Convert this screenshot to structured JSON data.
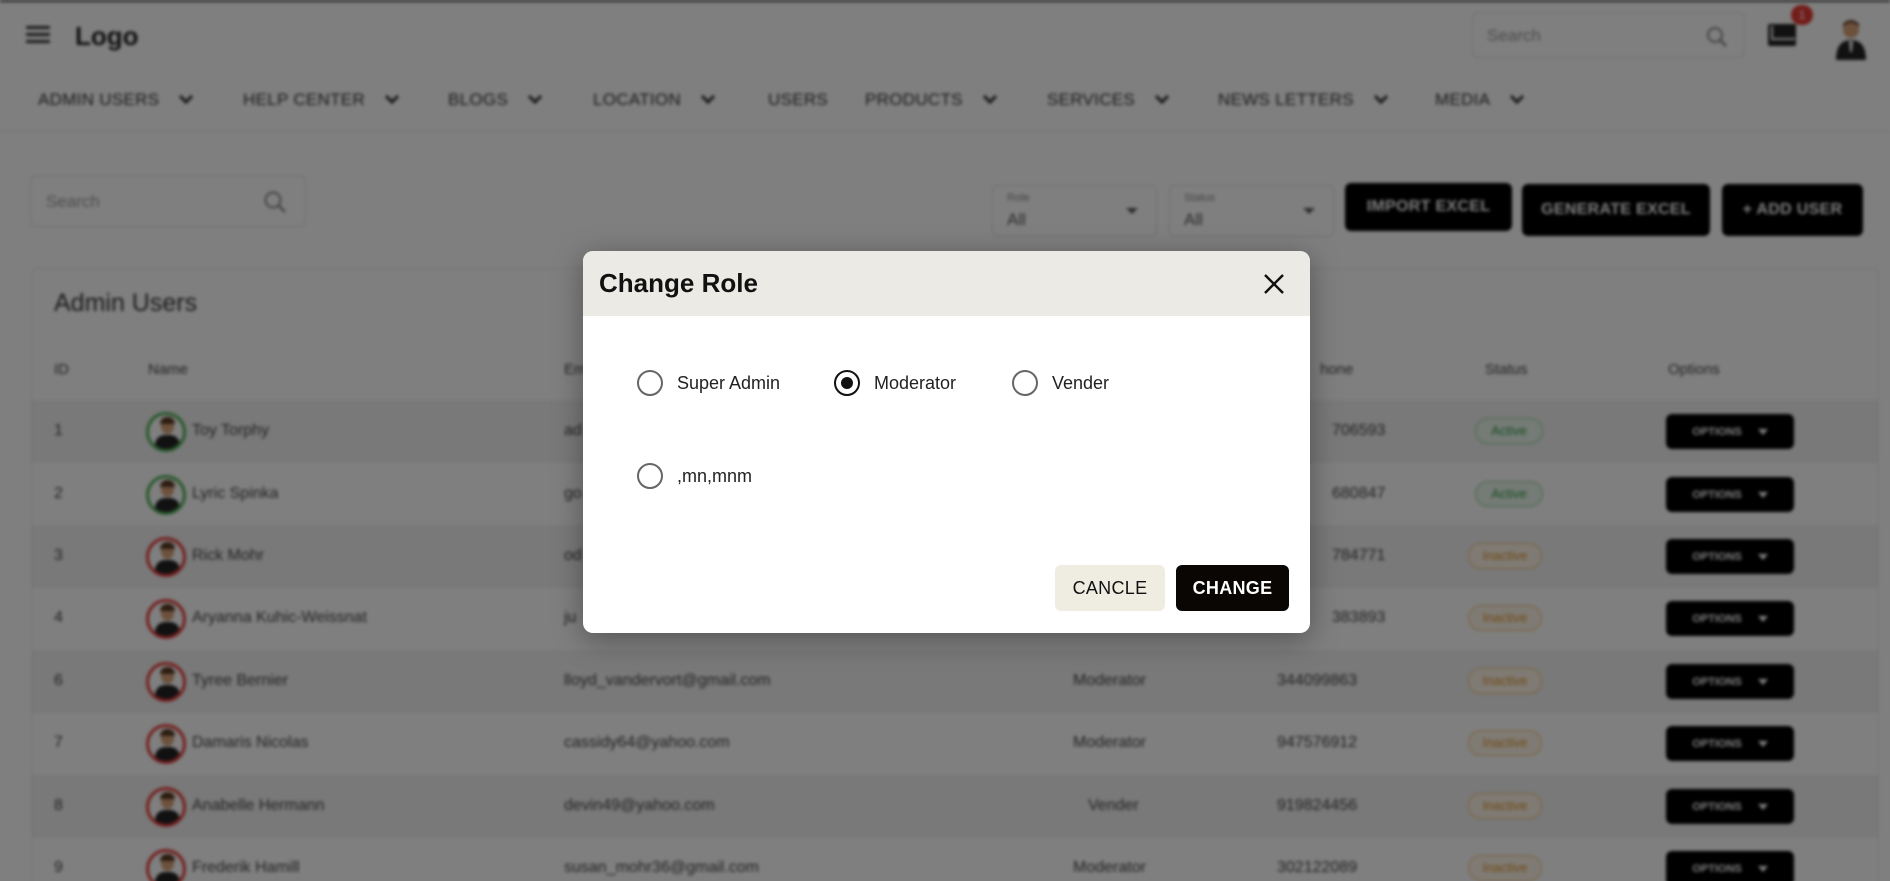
{
  "header": {
    "logo": "Logo",
    "search_placeholder": "Search",
    "notification_count": "1",
    "icons": [
      "menu-icon",
      "search-icon",
      "mail-icon",
      "profile-avatar"
    ]
  },
  "nav": {
    "items": [
      {
        "label": "ADMIN USERS",
        "has_dropdown": true
      },
      {
        "label": "HELP CENTER",
        "has_dropdown": true
      },
      {
        "label": "BLOGS",
        "has_dropdown": true
      },
      {
        "label": "LOCATION",
        "has_dropdown": true
      },
      {
        "label": "USERS",
        "has_dropdown": false
      },
      {
        "label": "PRODUCTS",
        "has_dropdown": true
      },
      {
        "label": "SERVICES",
        "has_dropdown": true
      },
      {
        "label": "NEWS LETTERS",
        "has_dropdown": true
      },
      {
        "label": "MEDIA",
        "has_dropdown": true
      }
    ]
  },
  "filters": {
    "search_placeholder": "Search",
    "role": {
      "label": "Role",
      "value": "All"
    },
    "status": {
      "label": "Status",
      "value": "All"
    },
    "import_label": "IMPORT EXCEL",
    "generate_label": "GENERATE EXCEL",
    "add_label": "+ ADD USER"
  },
  "table": {
    "title": "Admin Users",
    "headers": {
      "id": "ID",
      "name": "Name",
      "email": "Em",
      "phone": "hone",
      "status": "Status",
      "options": "Options"
    },
    "option_label": "OPTIONS",
    "rows": [
      {
        "id": "1",
        "name": "Toy Torphy",
        "email": "ad",
        "role": "",
        "phone": "706593",
        "status": "Active"
      },
      {
        "id": "2",
        "name": "Lyric Spinka",
        "email": "go",
        "role": "",
        "phone": "680847",
        "status": "Active"
      },
      {
        "id": "3",
        "name": "Rick Mohr",
        "email": "od",
        "role": "",
        "phone": "784771",
        "status": "Inactive"
      },
      {
        "id": "4",
        "name": "Aryanna Kuhic-Weissnat",
        "email": "ju",
        "role": "",
        "phone": "383893",
        "status": "Inactive"
      },
      {
        "id": "6",
        "name": "Tyree Bernier",
        "email": "lloyd_vandervort@gmail.com",
        "role": "Moderator",
        "phone": "344099863",
        "status": "Inactive"
      },
      {
        "id": "7",
        "name": "Damaris Nicolas",
        "email": "cassidy64@yahoo.com",
        "role": "Moderator",
        "phone": "947576912",
        "status": "Inactive"
      },
      {
        "id": "8",
        "name": "Anabelle Hermann",
        "email": "devin49@yahoo.com",
        "role": "Vender",
        "phone": "919824456",
        "status": "Inactive"
      },
      {
        "id": "9",
        "name": "Frederik Hamill",
        "email": "susan_mohr36@gmail.com",
        "role": "Moderator",
        "phone": "302122089",
        "status": "Inactive"
      }
    ]
  },
  "dialog": {
    "title": "Change Role",
    "options": [
      {
        "label": "Super Admin",
        "checked": false
      },
      {
        "label": "Moderator",
        "checked": true
      },
      {
        "label": "Vender",
        "checked": false
      },
      {
        "label": ",mn,mnm",
        "checked": false
      }
    ],
    "cancel_label": "CANCLE",
    "change_label": "CHANGE"
  }
}
